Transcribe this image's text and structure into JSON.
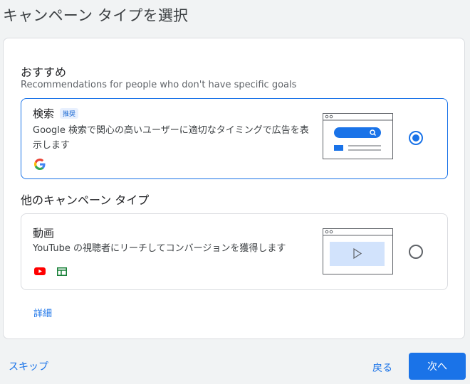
{
  "page": {
    "title": "キャンペーン タイプを選択"
  },
  "recommended": {
    "heading": "おすすめ",
    "subheading": "Recommendations for people who don't have specific goals",
    "option": {
      "title": "検索",
      "badge": "推奨",
      "description": "Google 検索で関心の高いユーザーに適切なタイミングで広告を表示します",
      "selected": true,
      "icons": [
        "google-icon"
      ]
    }
  },
  "other": {
    "heading": "他のキャンペーン タイプ",
    "option": {
      "title": "動画",
      "description": "YouTube の視聴者にリーチしてコンバージョンを獲得します",
      "selected": false,
      "icons": [
        "youtube-icon",
        "display-network-icon"
      ]
    },
    "details_link": "詳細"
  },
  "footer": {
    "skip_label": "スキップ",
    "back_label": "戻る",
    "next_label": "次へ"
  },
  "colors": {
    "accent": "#1a73e8",
    "background": "#f1f3f4",
    "youtube_red": "#ff0000",
    "display_green": "#188038"
  }
}
